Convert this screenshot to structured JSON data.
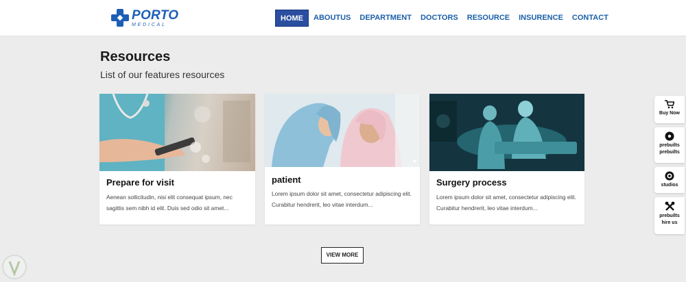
{
  "brand": {
    "name": "PORTO",
    "tagline": "MEDICAL",
    "color": "#1d5fb5"
  },
  "nav": {
    "items": [
      {
        "label": "HOME",
        "active": true
      },
      {
        "label": "ABOUTUS"
      },
      {
        "label": "DEPARTMENT"
      },
      {
        "label": "DOCTORS"
      },
      {
        "label": "RESOURCE"
      },
      {
        "label": "INSURENCE"
      },
      {
        "label": "CONTACT"
      }
    ]
  },
  "section": {
    "title": "Resources",
    "subtitle": "List of our features resources"
  },
  "cards": [
    {
      "title": "Prepare for visit",
      "text": "Aenean sollicitudin, nisi elit consequat ipsum, nec sagittis sem nibh id elit. Duis sed odio sit amet...",
      "image": "nurse-with-tablet-photo"
    },
    {
      "title": "patient",
      "text": "Lorem ipsum dolor sit amet, consectetur adipiscing elit. Curabitur hendrerit, leo vitae interdum...",
      "image": "nurse-with-elderly-patient-photo"
    },
    {
      "title": "Surgery process",
      "text": "Lorem ipsum dolor sit amet, consectetur adipiscing elit. Curabitur hendrerit, leo vitae interdum...",
      "image": "surgeons-operating-photo"
    }
  ],
  "view_more_label": "VIEW MORE",
  "side_panel": [
    {
      "label": "Buy Now",
      "icon": "cart-icon"
    },
    {
      "label": "prebuilts prebuilts",
      "icon": "disc-icon"
    },
    {
      "label": "studios",
      "icon": "studio-icon"
    },
    {
      "label": "prebuilts hire us",
      "icon": "tools-icon"
    }
  ],
  "colors": {
    "nav_active_bg": "#2a4ea0",
    "nav_text": "#1a5fa8",
    "page_bg": "#ececec"
  }
}
